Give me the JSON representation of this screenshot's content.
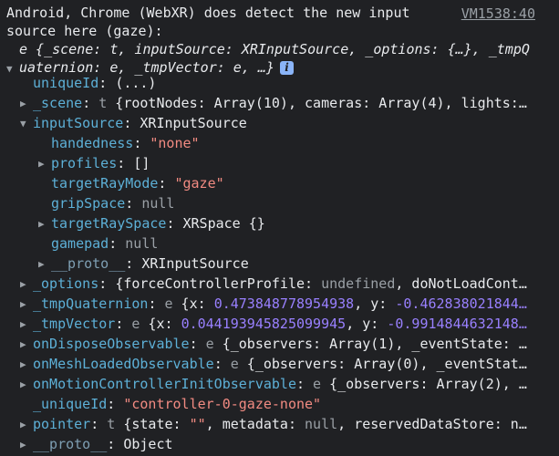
{
  "header": {
    "message": "Android, Chrome (WebXR) does detect the new input source here (gaze):",
    "source_link": "VM1538:40"
  },
  "summary": {
    "line1": "e {_scene: t, inputSource: XRInputSource, _options: {…}, _tmpQ",
    "line2": "uaternion: e, _tmpVector: e, …}",
    "info_badge": "i"
  },
  "rows": {
    "uniqueId": {
      "key": "uniqueId",
      "sep": ": ",
      "value": "(...)"
    },
    "scene": {
      "key": "_scene",
      "sep": ": ",
      "type": "t",
      "value": " {rootNodes: Array(10), cameras: Array(4), lights:…"
    },
    "inputSource": {
      "key": "inputSource",
      "sep": ": ",
      "value": "XRInputSource"
    },
    "handedness": {
      "key": "handedness",
      "sep": ": ",
      "value": "\"none\""
    },
    "profiles": {
      "key": "profiles",
      "sep": ": ",
      "value": "[]"
    },
    "targetRayMode": {
      "key": "targetRayMode",
      "sep": ": ",
      "value": "\"gaze\""
    },
    "gripSpace": {
      "key": "gripSpace",
      "sep": ": ",
      "value": "null"
    },
    "targetRaySpace": {
      "key": "targetRaySpace",
      "sep": ": ",
      "value": "XRSpace {}"
    },
    "gamepad": {
      "key": "gamepad",
      "sep": ": ",
      "value": "null"
    },
    "proto_input": {
      "key": "__proto__",
      "sep": ": ",
      "value": "XRInputSource"
    },
    "options": {
      "key": "_options",
      "sep": ": ",
      "pre": "{forceControllerProfile: ",
      "undef": "undefined",
      "post": ", doNotLoadCont…"
    },
    "tmpQuaternion": {
      "key": "_tmpQuaternion",
      "sep": ": ",
      "type": "e",
      "pre": " {x: ",
      "num1": "0.473848778954938",
      "mid": ", y: ",
      "num2": "-0.462838021844…"
    },
    "tmpVector": {
      "key": "_tmpVector",
      "sep": ": ",
      "type": "e",
      "pre": " {x: ",
      "num1": "0.044193945825099945",
      "mid": ", y: ",
      "num2": "-0.9914844632148…"
    },
    "onDispose": {
      "key": "onDisposeObservable",
      "sep": ": ",
      "type": "e",
      "value": " {_observers: Array(1), _eventState: …"
    },
    "onMeshLoaded": {
      "key": "onMeshLoadedObservable",
      "sep": ": ",
      "type": "e",
      "value": " {_observers: Array(0), _eventStat…"
    },
    "onMotionInit": {
      "key": "onMotionControllerInitObservable",
      "sep": ": ",
      "type": "e",
      "value": " {_observers: Array(2), …"
    },
    "uniqueId2": {
      "key": "_uniqueId",
      "sep": ": ",
      "value": "\"controller-0-gaze-none\""
    },
    "pointer": {
      "key": "pointer",
      "sep": ": ",
      "type": "t",
      "pre": " {state: ",
      "str": "\"\"",
      "mid": ", metadata: ",
      "nul": "null",
      "post": ", reservedDataStore: n…"
    },
    "proto_root": {
      "key": "__proto__",
      "sep": ": ",
      "value": "Object"
    }
  },
  "icons": {
    "expanded": "▼",
    "collapsed": "▶"
  },
  "colors": {
    "background": "#202124",
    "key": "#5db0d7",
    "string": "#f28b82",
    "number": "#9980ff",
    "dim": "#9aa0a6"
  }
}
